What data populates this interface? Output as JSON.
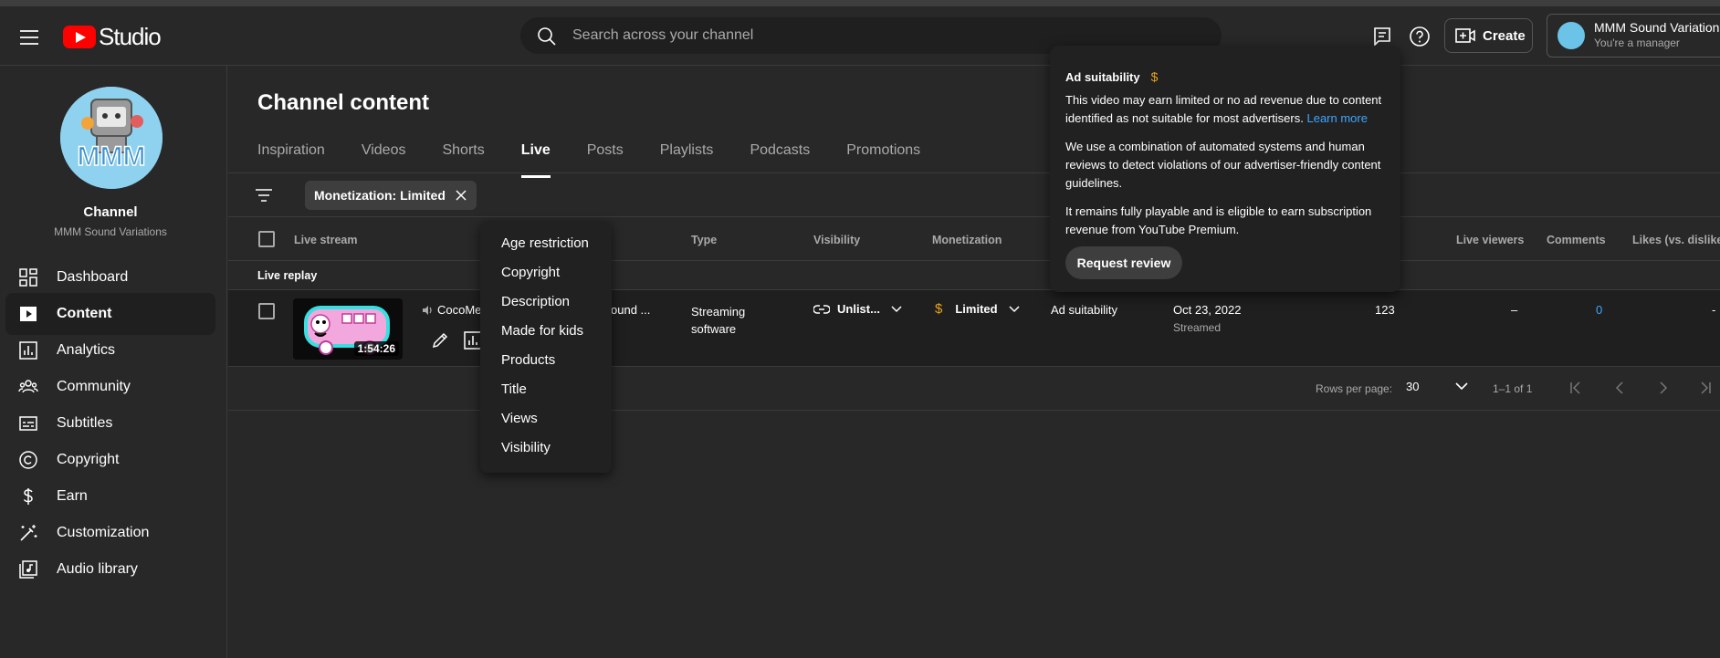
{
  "header": {
    "logo_text": "Studio",
    "search_placeholder": "Search across your channel",
    "create_label": "Create",
    "account_name": "MMM Sound Variations",
    "account_role": "You're a manager"
  },
  "sidebar": {
    "channel_title": "Channel",
    "channel_name": "MMM Sound Variations",
    "items": [
      {
        "label": "Dashboard",
        "icon": "dashboard-icon"
      },
      {
        "label": "Content",
        "icon": "content-icon",
        "active": true
      },
      {
        "label": "Analytics",
        "icon": "analytics-icon"
      },
      {
        "label": "Community",
        "icon": "community-icon"
      },
      {
        "label": "Subtitles",
        "icon": "subtitles-icon"
      },
      {
        "label": "Copyright",
        "icon": "copyright-icon"
      },
      {
        "label": "Earn",
        "icon": "earn-icon"
      },
      {
        "label": "Customization",
        "icon": "customization-icon"
      },
      {
        "label": "Audio library",
        "icon": "audio-library-icon"
      }
    ]
  },
  "main": {
    "title": "Channel content",
    "tabs": [
      {
        "label": "Inspiration"
      },
      {
        "label": "Videos"
      },
      {
        "label": "Shorts"
      },
      {
        "label": "Live",
        "active": true
      },
      {
        "label": "Posts"
      },
      {
        "label": "Playlists"
      },
      {
        "label": "Podcasts"
      },
      {
        "label": "Promotions"
      }
    ],
    "filter_chip": "Monetization: Limited",
    "columns": {
      "live_stream": "Live stream",
      "type": "Type",
      "visibility": "Visibility",
      "monetization": "Monetization",
      "live_viewers": "Live viewers",
      "comments": "Comments",
      "likes": "Likes (vs. dislikes)"
    },
    "section_label": "Live replay",
    "row": {
      "duration": "1:54:26",
      "title_start": "CocoMe",
      "title_end": "ound ...",
      "type": "Streaming software",
      "visibility": "Unlist...",
      "monetization": "Limited",
      "restrictions": "Ad suitability",
      "date": "Oct 23, 2022",
      "date_status": "Streamed",
      "views": "123",
      "live_viewers": "–",
      "comments": "0",
      "likes": "-"
    },
    "pagination": {
      "rows_label": "Rows per page:",
      "rows_value": "30",
      "range": "1–1 of 1"
    }
  },
  "dropdown": {
    "options": [
      "Age restriction",
      "Copyright",
      "Description",
      "Made for kids",
      "Products",
      "Title",
      "Views",
      "Visibility"
    ]
  },
  "tooltip": {
    "title": "Ad suitability",
    "p1": "This video may earn limited or no ad revenue due to content identified as not suitable for most advertisers.",
    "p1_link": "Learn more",
    "p2": "We use a combination of automated systems and human reviews to detect violations of our advertiser-friendly content guidelines.",
    "p3": "It remains fully playable and is eligible to earn subscription revenue from YouTube Premium.",
    "button": "Request review"
  },
  "colors": {
    "background": "#282828",
    "accent_link": "#3ea6ff",
    "monetization_limited": "#e8a21a",
    "brand_red": "#ff0000"
  }
}
